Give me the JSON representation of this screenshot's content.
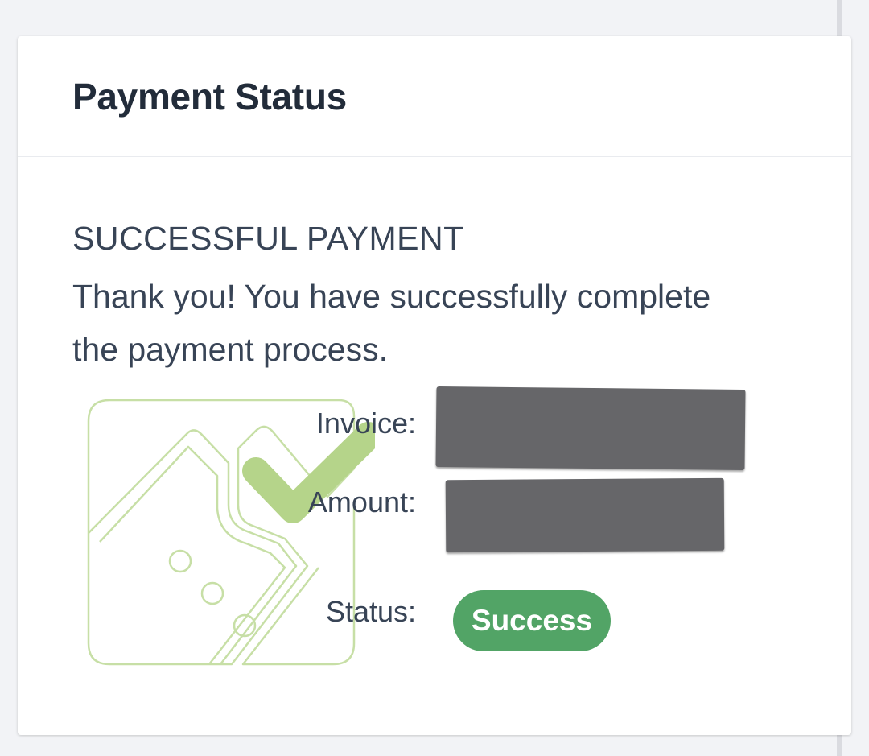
{
  "card": {
    "title": "Payment Status"
  },
  "result": {
    "heading": "SUCCESSFUL PAYMENT",
    "message": "Thank you! You have successfully complete the payment process."
  },
  "details": {
    "invoice_label": "Invoice:",
    "amount_label": "Amount:",
    "status_label": "Status:",
    "status_value": "Success"
  },
  "icons": {
    "illustration": "payment-success-check-icon"
  },
  "colors": {
    "success_badge": "#52a466",
    "check_mark": "#b5d48a",
    "illustration_outline": "#c7dfa6",
    "redaction": "#666669"
  }
}
